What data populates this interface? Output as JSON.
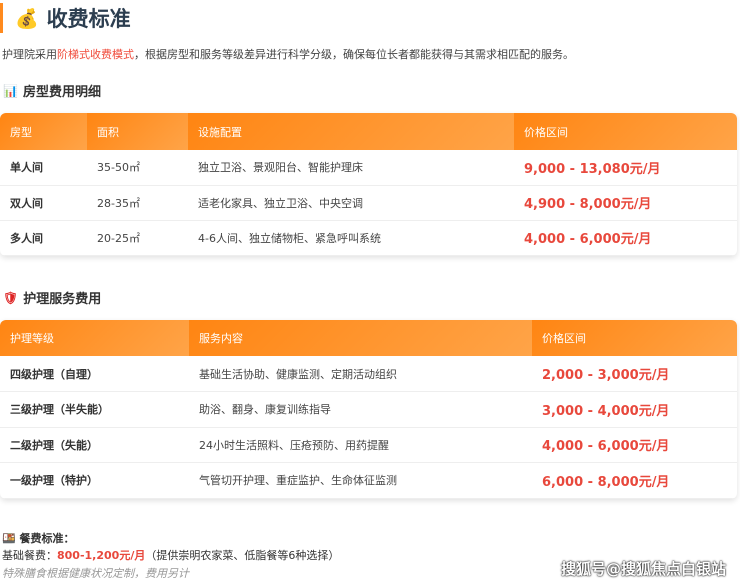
{
  "title": "收费标准",
  "intro": {
    "pre": "护理院采用",
    "highlight": "阶梯式收费模式",
    "post": "，根据房型和服务等级差异进行科学分级，确保每位长者都能获得与其需求相匹配的服务。"
  },
  "room": {
    "heading": "房型费用明细",
    "headers": [
      "房型",
      "面积",
      "设施配置",
      "价格区间"
    ],
    "rows": [
      [
        "单人间",
        "35-50㎡",
        "独立卫浴、景观阳台、智能护理床",
        "9,000 - 13,080元/月"
      ],
      [
        "双人间",
        "28-35㎡",
        "适老化家具、独立卫浴、中央空调",
        "4,900 - 8,000元/月"
      ],
      [
        "多人间",
        "20-25㎡",
        "4-6人间、独立储物柜、紧急呼叫系统",
        "4,000 - 6,000元/月"
      ]
    ]
  },
  "care": {
    "heading": "护理服务费用",
    "headers": [
      "护理等级",
      "服务内容",
      "价格区间"
    ],
    "rows": [
      [
        "四级护理（自理）",
        "基础生活协助、健康监测、定期活动组织",
        "2,000 - 3,000元/月"
      ],
      [
        "三级护理（半失能）",
        "助浴、翻身、康复训练指导",
        "3,000 - 4,000元/月"
      ],
      [
        "二级护理（失能）",
        "24小时生活照料、压疮预防、用药提醒",
        "4,000 - 6,000元/月"
      ],
      [
        "一级护理（特护）",
        "气管切开护理、重症监护、生命体征监测",
        "6,000 - 8,000元/月"
      ]
    ]
  },
  "meal": {
    "heading": "餐费标准：",
    "label": "基础餐费：",
    "price": "800-1,200元/月",
    "desc": "（提供崇明农家菜、低脂餐等6种选择）",
    "note": "特殊膳食根据健康状况定制，费用另计"
  },
  "watermark": "搜狐号@搜狐焦点白银站"
}
